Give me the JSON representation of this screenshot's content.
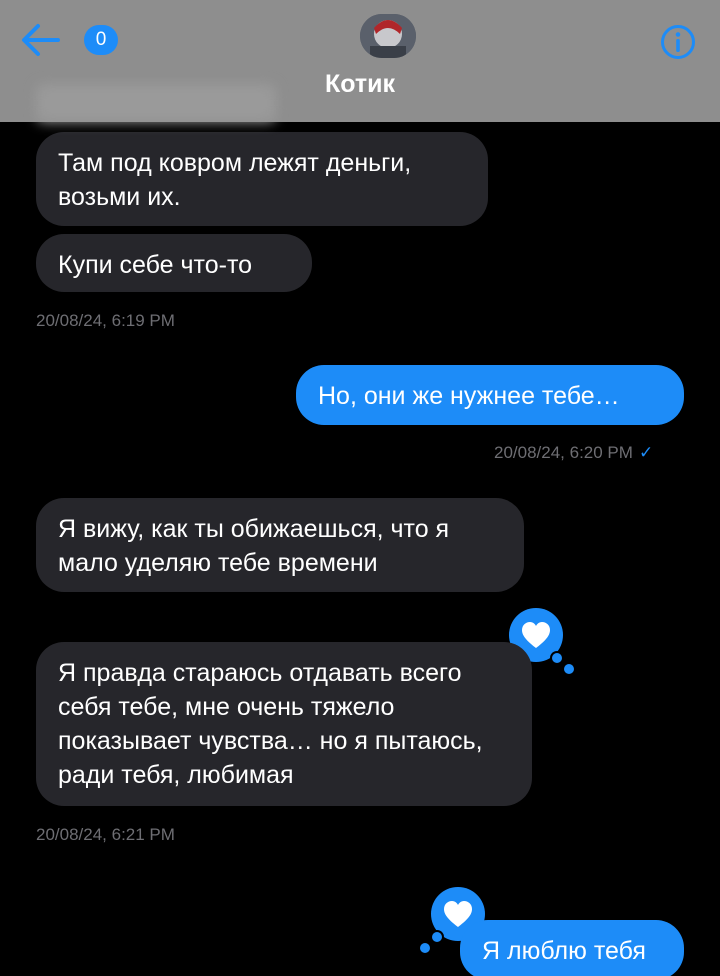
{
  "header": {
    "title": "Котик",
    "unread_count": "0"
  },
  "messages": [
    {
      "side": "in",
      "text": "Там под ковром лежят деньги, возьми их."
    },
    {
      "side": "in",
      "text": "Купи себе что-то"
    },
    {
      "side": "out",
      "text": "Но, они же нужнее тебе…"
    },
    {
      "side": "in",
      "text": "Я вижу, как ты обижаешься, что я мало уделяю тебе времени"
    },
    {
      "side": "in",
      "text": "Я правда стараюсь отдавать всего себя тебе, мне очень тяжело показывает чувства… но я пытаюсь, ради тебя, любимая"
    },
    {
      "side": "out",
      "text": "Я люблю тебя"
    }
  ],
  "timestamps": {
    "t1": "20/08/24, 6:19 PM",
    "t2": "20/08/24, 6:20 PM",
    "t3": "20/08/24, 6:21 PM"
  },
  "colors": {
    "accent": "#1d8cf8",
    "incoming_bubble": "#26262b",
    "header_bg": "#8e8e8e"
  },
  "icons": [
    "back-arrow-icon",
    "info-icon",
    "heart-reaction-icon",
    "read-check-icon"
  ]
}
